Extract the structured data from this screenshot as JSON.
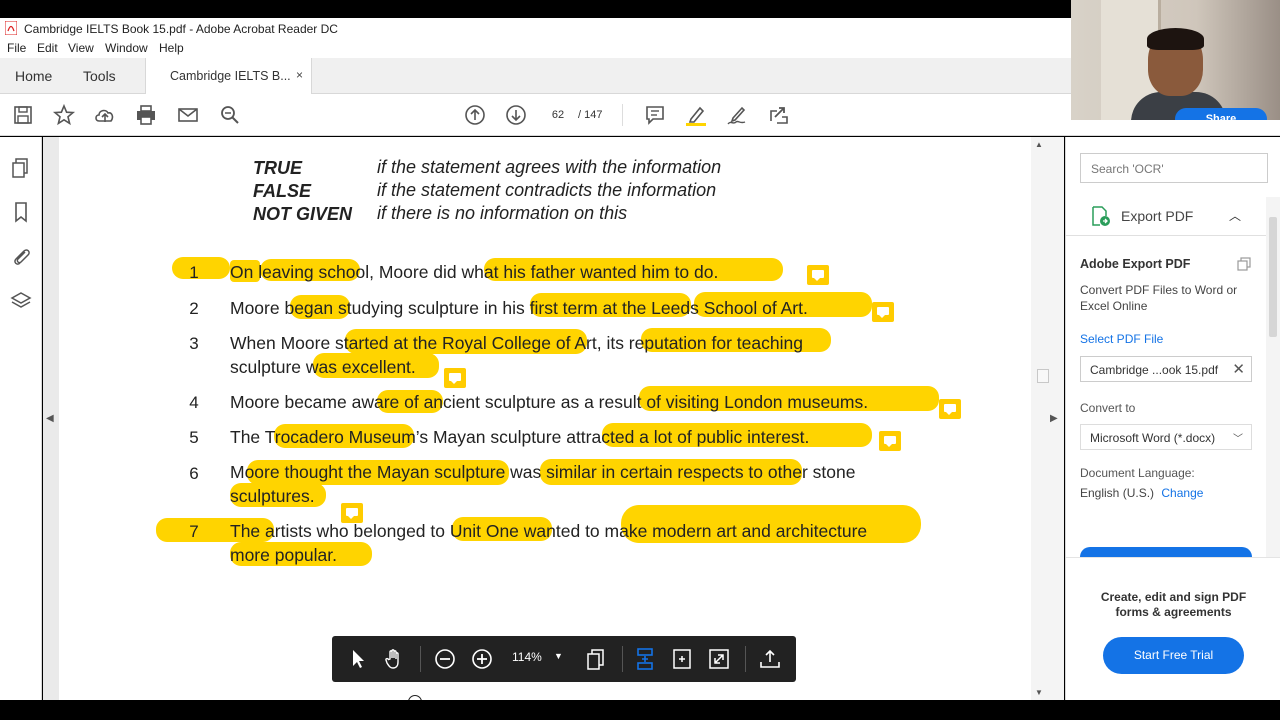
{
  "window": {
    "title": "Cambridge IELTS Book 15.pdf - Adobe Acrobat Reader DC"
  },
  "menu": [
    "File",
    "Edit",
    "View",
    "Window",
    "Help"
  ],
  "tabs": {
    "home": "Home",
    "tools": "Tools",
    "document": "Cambridge IELTS B...",
    "close": "×"
  },
  "toolbar": {
    "current_page": "62",
    "total_pages": "/ 147"
  },
  "legend": [
    {
      "key": "TRUE",
      "desc": "if the statement agrees with the information"
    },
    {
      "key": "FALSE",
      "desc": "if the statement contradicts the information"
    },
    {
      "key": "NOT GIVEN",
      "desc": "if there is no information on this"
    }
  ],
  "statements": [
    {
      "num": "1",
      "line1": "On leaving school, Moore did what his father wanted him to do.",
      "line2": ""
    },
    {
      "num": "2",
      "line1": "Moore began studying sculpture in his first term at the Leeds School of Art.",
      "line2": ""
    },
    {
      "num": "3",
      "line1": "When Moore started at the Royal College of Art, its reputation for teaching",
      "line2": "sculpture was excellent."
    },
    {
      "num": "4",
      "line1": "Moore became aware of ancient sculpture as a result of visiting London museums.",
      "line2": ""
    },
    {
      "num": "5",
      "line1": "The Trocadero Museum’s Mayan sculpture attracted a lot of public interest.",
      "line2": ""
    },
    {
      "num": "6",
      "line1": "Moore thought the Mayan sculpture was similar in certain respects to other stone",
      "line2": "sculptures."
    },
    {
      "num": "7",
      "line1": "The artists who belonged to Unit One wanted to make modern art and architecture",
      "line2": "more popular."
    }
  ],
  "float_toolbar": {
    "zoom": "114%"
  },
  "right_panel": {
    "search_placeholder": "Search 'OCR'",
    "export_label": "Export PDF",
    "title": "Adobe Export PDF",
    "description": "Convert PDF Files to Word or Excel Online",
    "select_link": "Select PDF File",
    "file_name": "Cambridge ...ook 15.pdf",
    "convert_to_label": "Convert to",
    "convert_to_value": "Microsoft Word (*.docx)",
    "doc_lang_label": "Document Language:",
    "doc_lang_value": "English (U.S.)",
    "change_link": "Change",
    "promo_text": "Create, edit and sign PDF forms & agreements",
    "trial_button": "Start Free Trial"
  },
  "webcam": {
    "share_label": "Share"
  },
  "colors": {
    "highlight": "#ffd400",
    "accent": "#1473e6"
  }
}
